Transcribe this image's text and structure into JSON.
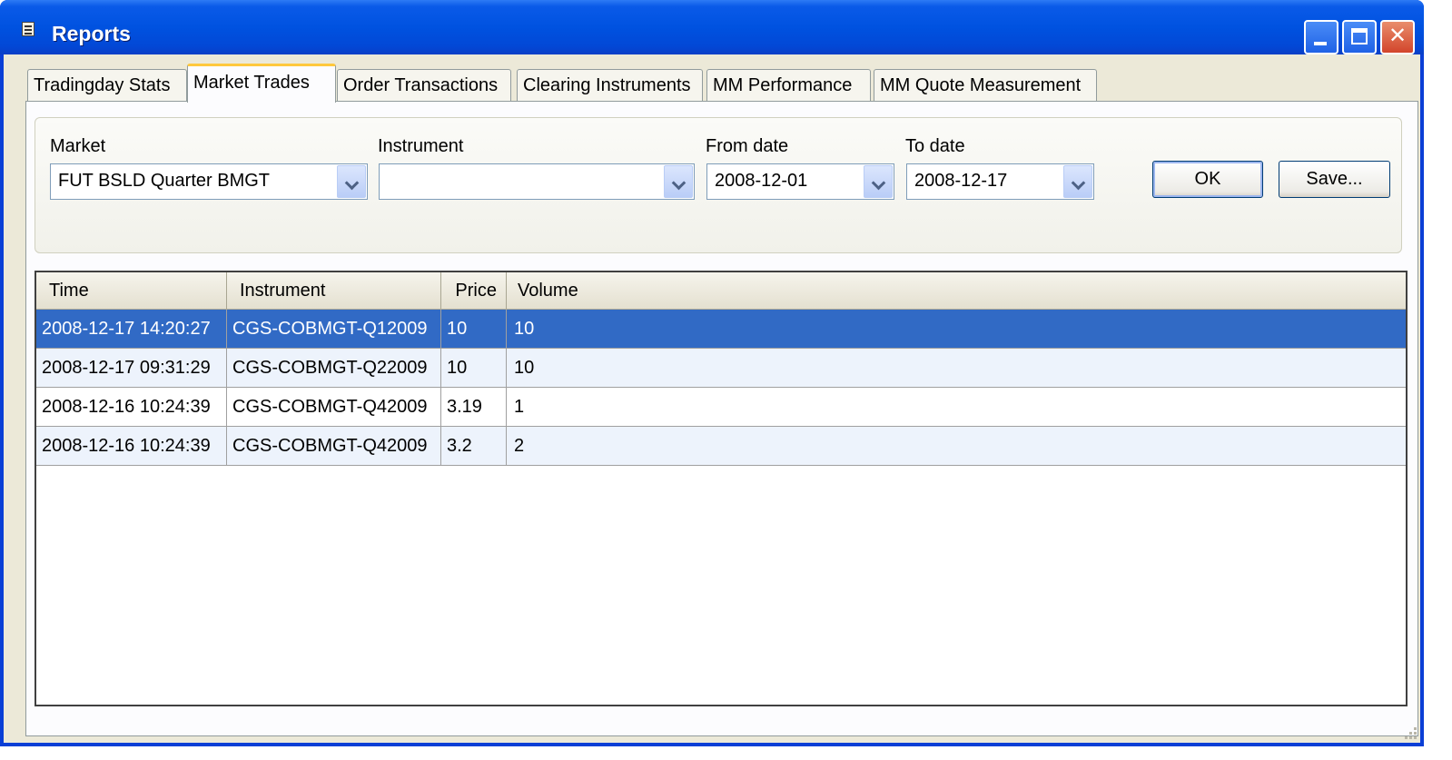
{
  "window": {
    "title": "Reports"
  },
  "tabs": [
    {
      "label": "Tradingday Stats"
    },
    {
      "label": "Market Trades"
    },
    {
      "label": "Order Transactions"
    },
    {
      "label": "Clearing Instruments"
    },
    {
      "label": "MM Performance"
    },
    {
      "label": "MM Quote Measurement"
    }
  ],
  "active_tab": "Market Trades",
  "filters": {
    "market": {
      "label": "Market",
      "value": "FUT BSLD Quarter BMGT"
    },
    "instrument": {
      "label": "Instrument",
      "value": ""
    },
    "from_date": {
      "label": "From date",
      "value": "2008-12-01"
    },
    "to_date": {
      "label": "To date",
      "value": "2008-12-17"
    },
    "ok_label": "OK",
    "save_label": "Save..."
  },
  "table": {
    "columns": [
      "Time",
      "Instrument",
      "Price",
      "Volume"
    ],
    "rows": [
      [
        "2008-12-17 14:20:27",
        "CGS-COBMGT-Q12009",
        "10",
        "10"
      ],
      [
        "2008-12-17 09:31:29",
        "CGS-COBMGT-Q22009",
        "10",
        "10"
      ],
      [
        "2008-12-16 10:24:39",
        "CGS-COBMGT-Q42009",
        "3.19",
        "1"
      ],
      [
        "2008-12-16 10:24:39",
        "CGS-COBMGT-Q42009",
        "3.2",
        "2"
      ]
    ],
    "selected_row": 0
  },
  "colors": {
    "titlebar": "#0052e0",
    "selection": "#316ac5",
    "client_bg": "#ece9d8",
    "active_tab_accent": "#ffc83c"
  }
}
